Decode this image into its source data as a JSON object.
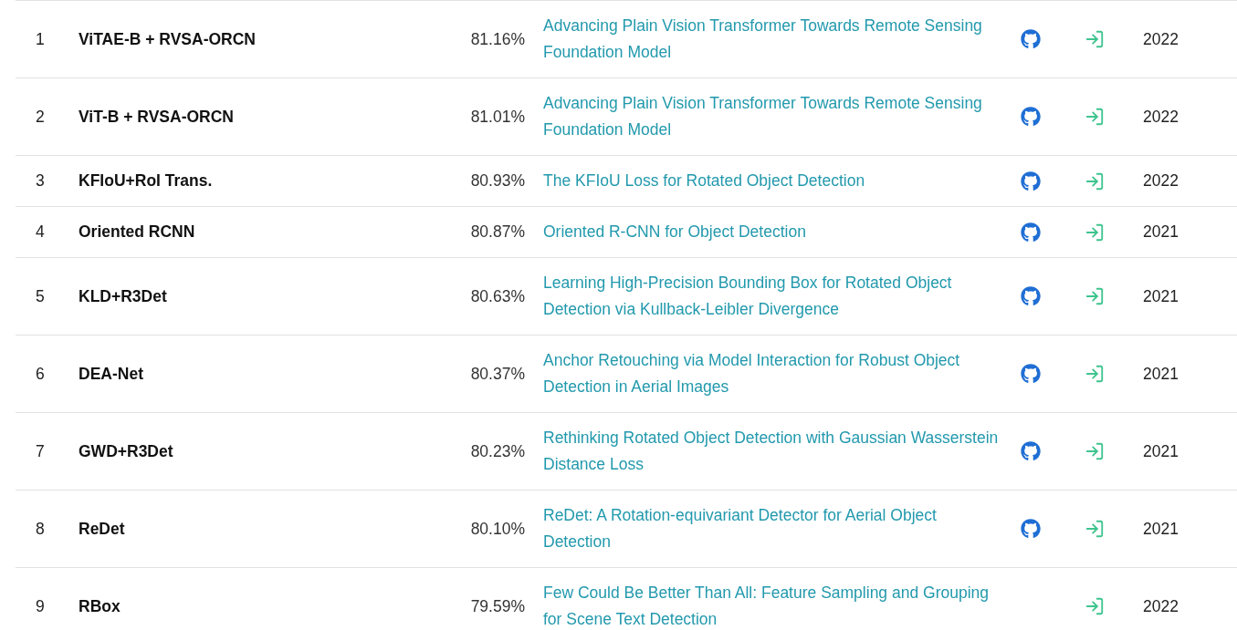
{
  "rows": [
    {
      "rank": "1",
      "model": "ViTAE-B + RVSA-ORCN",
      "score": "81.16%",
      "paper": "Advancing Plain Vision Transformer Towards Remote Sensing Foundation Model",
      "has_code": true,
      "year": "2022"
    },
    {
      "rank": "2",
      "model": "ViT-B + RVSA-ORCN",
      "score": "81.01%",
      "paper": "Advancing Plain Vision Transformer Towards Remote Sensing Foundation Model",
      "has_code": true,
      "year": "2022"
    },
    {
      "rank": "3",
      "model": "KFIoU+RoI Trans.",
      "score": "80.93%",
      "paper": "The KFIoU Loss for Rotated Object Detection",
      "has_code": true,
      "year": "2022"
    },
    {
      "rank": "4",
      "model": "Oriented RCNN",
      "score": "80.87%",
      "paper": "Oriented R-CNN for Object Detection",
      "has_code": true,
      "year": "2021"
    },
    {
      "rank": "5",
      "model": "KLD+R3Det",
      "score": "80.63%",
      "paper": "Learning High-Precision Bounding Box for Rotated Object Detection via Kullback-Leibler Divergence",
      "has_code": true,
      "year": "2021"
    },
    {
      "rank": "6",
      "model": "DEA-Net",
      "score": "80.37%",
      "paper": "Anchor Retouching via Model Interaction for Robust Object Detection in Aerial Images",
      "has_code": true,
      "year": "2021"
    },
    {
      "rank": "7",
      "model": "GWD+R3Det",
      "score": "80.23%",
      "paper": "Rethinking Rotated Object Detection with Gaussian Wasserstein Distance Loss",
      "has_code": true,
      "year": "2021"
    },
    {
      "rank": "8",
      "model": "ReDet",
      "score": "80.10%",
      "paper": "ReDet: A Rotation-equivariant Detector for Aerial Object Detection",
      "has_code": true,
      "year": "2021"
    },
    {
      "rank": "9",
      "model": "RBox",
      "score": "79.59%",
      "paper": "Few Could Be Better Than All: Feature Sampling and Grouping for Scene Text Detection",
      "has_code": false,
      "year": "2022"
    }
  ]
}
